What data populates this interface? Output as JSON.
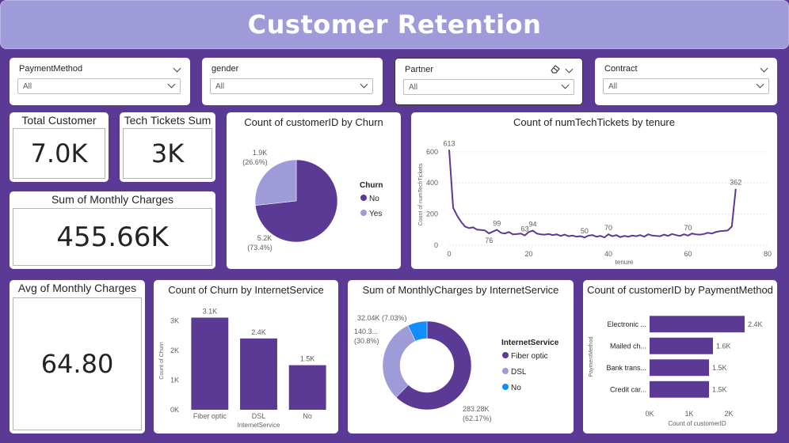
{
  "header": {
    "title": "Customer Retention"
  },
  "slicers": [
    {
      "title": "PaymentMethod",
      "value": "All"
    },
    {
      "title": "gender",
      "value": "All"
    },
    {
      "title": "Partner",
      "value": "All"
    },
    {
      "title": "Contract",
      "value": "All"
    }
  ],
  "kpis": {
    "total_customer": {
      "title": "Total Customer",
      "value": "7.0K"
    },
    "tech_tickets": {
      "title": "Tech Tickets Sum",
      "value": "3K"
    },
    "monthly_charges_sum": {
      "title": "Sum of Monthly Charges",
      "value": "455.66K"
    },
    "monthly_charges_avg": {
      "title": "Avg of Monthly Charges",
      "value": "64.80"
    }
  },
  "colors": {
    "primary": "#5b3a96",
    "light": "#9f9bd9",
    "accent_blue": "#118dff",
    "banner": "#9f9bd9"
  },
  "chart_data": [
    {
      "id": "churn_pie",
      "type": "pie",
      "title": "Count of customerID by Churn",
      "legend_title": "Churn",
      "legend_position": "right",
      "slices": [
        {
          "name": "No",
          "value": 5.2,
          "label": "5.2K",
          "pct_label": "(73.4%)",
          "color": "#5b3a96"
        },
        {
          "name": "Yes",
          "value": 1.9,
          "label": "1.9K",
          "pct_label": "(26.6%)",
          "color": "#9f9bd9"
        }
      ]
    },
    {
      "id": "tickets_line",
      "type": "line",
      "title": "Count of numTechTickets by tenure",
      "xlabel": "tenure",
      "ylabel": "Count of numTechTickets",
      "xlim": [
        0,
        80
      ],
      "ylim": [
        0,
        650
      ],
      "xticks": [
        "0",
        "20",
        "40",
        "60",
        "80"
      ],
      "yticks": [
        "0",
        "200",
        "400",
        "600"
      ],
      "grid": true,
      "x": [
        0,
        1,
        2,
        3,
        4,
        5,
        6,
        7,
        8,
        9,
        10,
        11,
        12,
        13,
        14,
        15,
        16,
        17,
        18,
        19,
        20,
        21,
        22,
        23,
        24,
        25,
        26,
        27,
        28,
        29,
        30,
        31,
        32,
        33,
        34,
        35,
        36,
        37,
        38,
        39,
        40,
        41,
        42,
        43,
        44,
        45,
        46,
        47,
        48,
        49,
        50,
        51,
        52,
        53,
        54,
        55,
        56,
        57,
        58,
        59,
        60,
        61,
        62,
        63,
        64,
        65,
        66,
        67,
        68,
        69,
        70,
        71,
        72
      ],
      "y": [
        613,
        240,
        190,
        150,
        120,
        110,
        115,
        100,
        98,
        95,
        76,
        88,
        99,
        80,
        75,
        85,
        70,
        72,
        75,
        63,
        85,
        94,
        75,
        70,
        68,
        72,
        65,
        70,
        60,
        68,
        58,
        62,
        55,
        58,
        50,
        62,
        65,
        55,
        60,
        50,
        70,
        58,
        65,
        52,
        60,
        55,
        62,
        58,
        65,
        55,
        70,
        62,
        60,
        58,
        68,
        60,
        72,
        65,
        60,
        70,
        62,
        75,
        70,
        68,
        72,
        80,
        75,
        85,
        90,
        92,
        95,
        120,
        362
      ],
      "data_labels": [
        {
          "x": 0,
          "y": 613,
          "text": "613",
          "pos": "above"
        },
        {
          "x": 10,
          "y": 76,
          "text": "76",
          "pos": "below"
        },
        {
          "x": 12,
          "y": 99,
          "text": "99",
          "pos": "above"
        },
        {
          "x": 19,
          "y": 63,
          "text": "63",
          "pos": "above"
        },
        {
          "x": 21,
          "y": 94,
          "text": "94",
          "pos": "above"
        },
        {
          "x": 34,
          "y": 50,
          "text": "50",
          "pos": "above"
        },
        {
          "x": 40,
          "y": 70,
          "text": "70",
          "pos": "above"
        },
        {
          "x": 60,
          "y": 70,
          "text": "70",
          "pos": "above"
        },
        {
          "x": 72,
          "y": 362,
          "text": "362",
          "pos": "above"
        }
      ]
    },
    {
      "id": "churn_internet_bar",
      "type": "bar",
      "title": "Count of Churn by InternetService",
      "xlabel": "InternetService",
      "ylabel": "Count of Churn",
      "categories": [
        "Fiber optic",
        "DSL",
        "No"
      ],
      "values": [
        3.1,
        2.4,
        1.5
      ],
      "value_labels": [
        "3.1K",
        "2.4K",
        "1.5K"
      ],
      "ylim": [
        0,
        3.3
      ],
      "yticks": [
        0,
        1,
        2,
        3
      ],
      "ytick_labels": [
        "0K",
        "1K",
        "2K",
        "3K"
      ]
    },
    {
      "id": "charges_donut",
      "type": "pie",
      "title": "Sum of MonthlyCharges by InternetService",
      "legend_title": "InternetService",
      "legend_position": "right",
      "slices": [
        {
          "name": "Fiber optic",
          "value": 283.28,
          "label": "283.28K",
          "pct_label": "(62.17%)",
          "color": "#5b3a96"
        },
        {
          "name": "DSL",
          "value": 140.34,
          "label": "140.3...",
          "pct_label": "(30.8%)",
          "color": "#9f9bd9"
        },
        {
          "name": "No",
          "value": 32.04,
          "label": "32.04K",
          "pct_label": "(7.03%)",
          "color": "#118dff"
        }
      ]
    },
    {
      "id": "payment_hbar",
      "type": "bar",
      "title": "Count of customerID by PaymentMethod",
      "xlabel": "Count of customerID",
      "ylabel": "PaymentMethod",
      "categories": [
        "Electronic ...",
        "Mailed ch...",
        "Bank trans...",
        "Credit car..."
      ],
      "values": [
        2.4,
        1.6,
        1.5,
        1.5
      ],
      "value_labels": [
        "2.4K",
        "1.6K",
        "1.5K",
        "1.5K"
      ],
      "xlim": [
        0,
        2.4
      ],
      "xticks": [
        0,
        1,
        2
      ],
      "xtick_labels": [
        "0K",
        "1K",
        "2K"
      ]
    }
  ]
}
